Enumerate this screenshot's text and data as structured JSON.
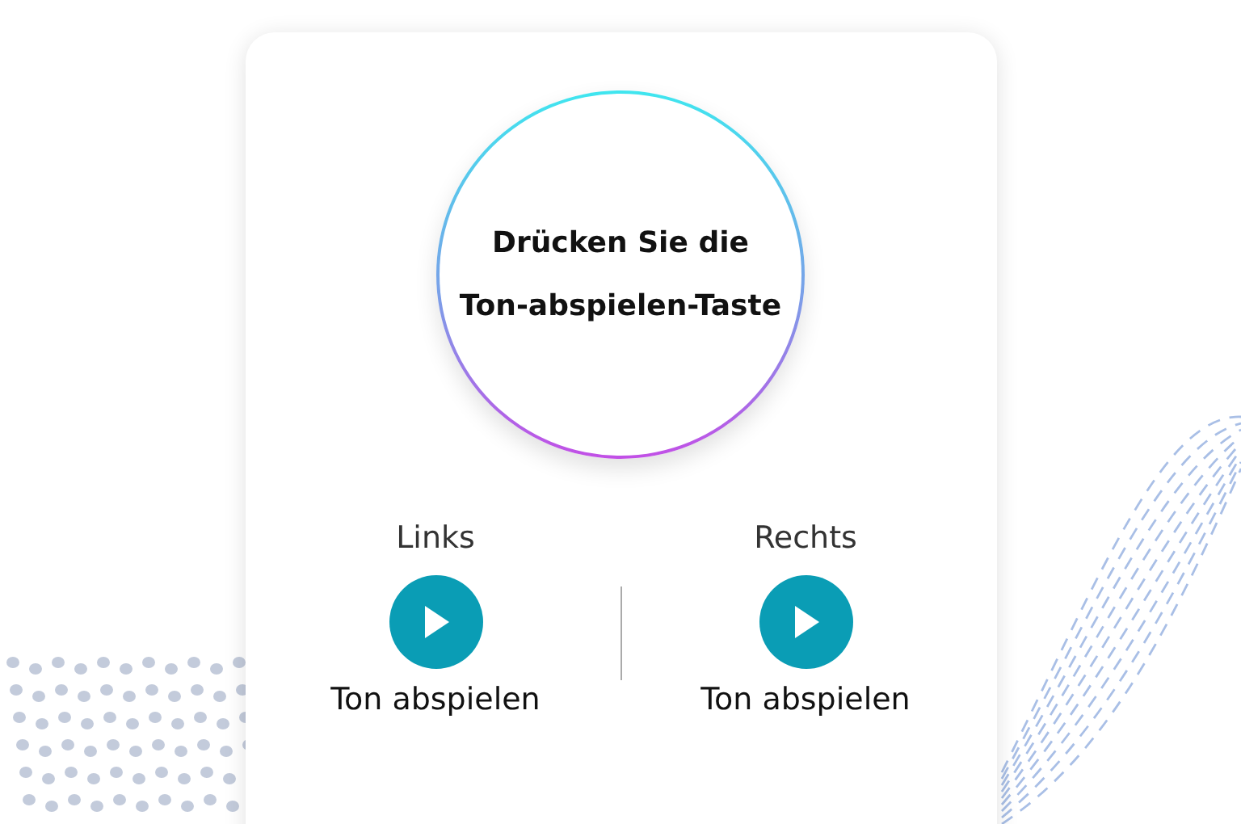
{
  "prompt": {
    "lines": [
      "Drücken Sie die",
      "Ton-abspielen-Taste"
    ]
  },
  "channels": [
    {
      "label": "Links",
      "button": "Ton abspielen"
    },
    {
      "label": "Rechts",
      "button": "Ton abspielen"
    }
  ]
}
